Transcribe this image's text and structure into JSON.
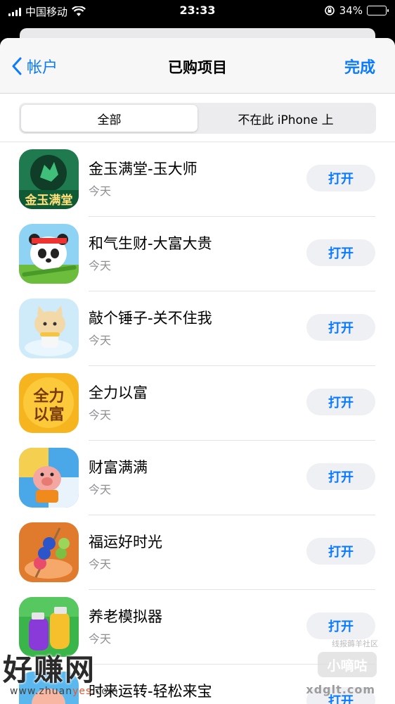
{
  "status_bar": {
    "carrier": "中国移动",
    "time": "23:33",
    "battery": "34%",
    "battery_level": 0.34,
    "icons": [
      "signal-bars-icon",
      "wifi-icon",
      "orientation-lock-icon",
      "battery-icon"
    ]
  },
  "nav": {
    "back_label": "帐户",
    "title": "已购项目",
    "done_label": "完成"
  },
  "segment": {
    "options": [
      "全部",
      "不在此 iPhone 上"
    ],
    "selected": "全部"
  },
  "apps": [
    {
      "name": "金玉满堂-玉大师",
      "date": "今天",
      "button": "打开",
      "icon_text": "金玉满堂",
      "icon": "jade-app-icon"
    },
    {
      "name": "和气生财-大富大贵",
      "date": "今天",
      "button": "打开",
      "icon": "panda-app-icon"
    },
    {
      "name": "敲个锤子-关不住我",
      "date": "今天",
      "button": "打开",
      "icon": "cat-app-icon"
    },
    {
      "name": "全力以富",
      "date": "今天",
      "button": "打开",
      "icon_text": "全力以富",
      "icon": "quanli-app-icon"
    },
    {
      "name": "财富满满",
      "date": "今天",
      "button": "打开",
      "icon": "pig-app-icon"
    },
    {
      "name": "福运好时光",
      "date": "今天",
      "button": "打开",
      "icon": "skewer-app-icon"
    },
    {
      "name": "养老模拟器",
      "date": "今天",
      "button": "打开",
      "icon": "potion-app-icon"
    },
    {
      "name": "时来运转-轻松来宝",
      "date": "",
      "button": "打开",
      "icon": "fortune-app-icon"
    }
  ],
  "watermarks": {
    "left_big": "好赚网",
    "left_url_a": "www.zhuan",
    "left_url_b": "yes",
    "left_url_c": ".com",
    "right_caption": "线报薅羊社区",
    "right_badge": "小嘀咕",
    "right_site": "xdglt.com"
  }
}
